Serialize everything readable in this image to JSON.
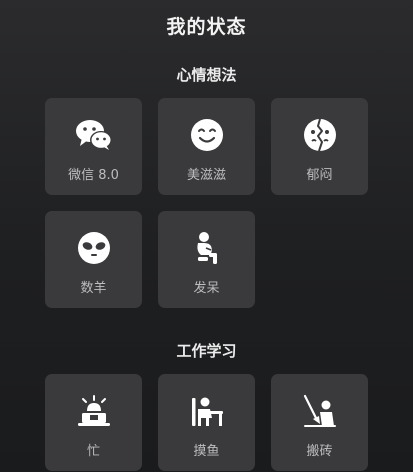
{
  "page": {
    "title": "我的状态"
  },
  "sections": [
    {
      "title": "心情想法",
      "items": [
        {
          "label": "微信 8.0",
          "icon": "wechat-icon"
        },
        {
          "label": "美滋滋",
          "icon": "smile-face-icon"
        },
        {
          "label": "郁闷",
          "icon": "split-face-icon"
        },
        {
          "label": "数羊",
          "icon": "sheep-face-icon"
        },
        {
          "label": "发呆",
          "icon": "sitting-figure-icon"
        }
      ]
    },
    {
      "title": "工作学习",
      "items": [
        {
          "label": "忙",
          "icon": "alarm-laptop-icon"
        },
        {
          "label": "摸鱼",
          "icon": "desk-person-icon"
        },
        {
          "label": "搬砖",
          "icon": "shovel-person-icon"
        }
      ]
    }
  ],
  "colors": {
    "background": "#232325",
    "tile": "#3a3a3d",
    "label": "#bdbdbf",
    "icon": "#ffffff"
  }
}
